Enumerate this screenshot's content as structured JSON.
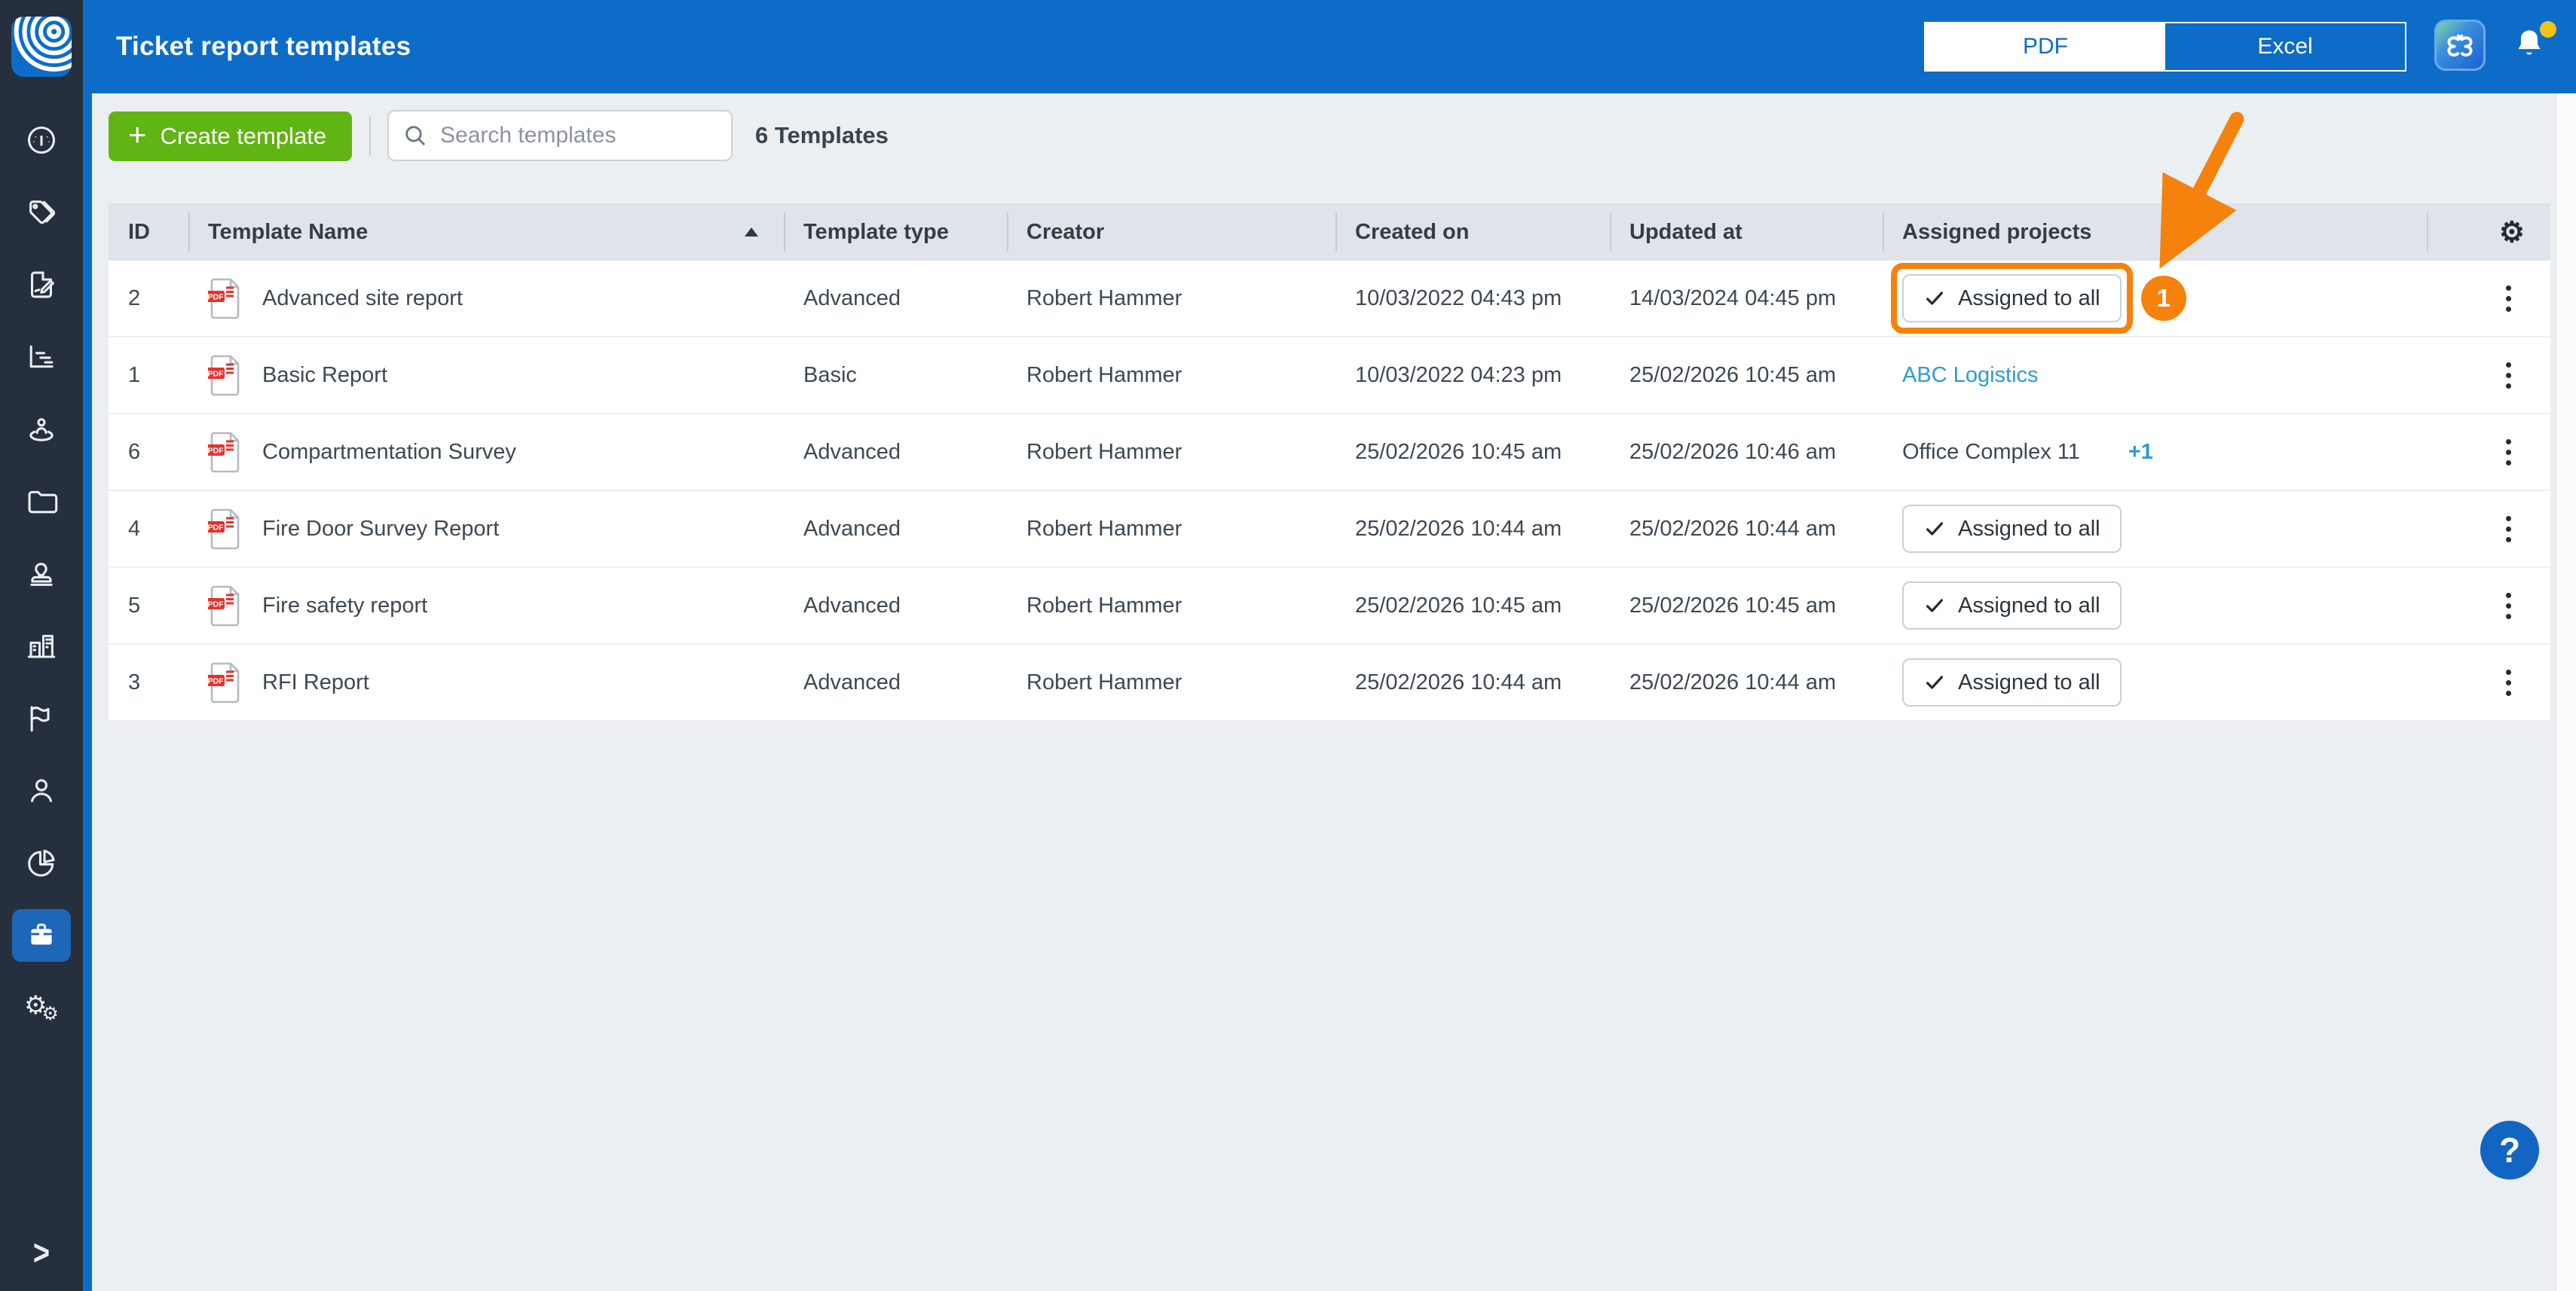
{
  "header": {
    "title": "Ticket report templates",
    "format_toggle": {
      "options": [
        "PDF",
        "Excel"
      ],
      "selected": "PDF"
    }
  },
  "sidebar": {
    "items": [
      {
        "icon": "gauge-icon"
      },
      {
        "icon": "tags-icon"
      },
      {
        "icon": "document-edit-icon"
      },
      {
        "icon": "bar-chart-icon"
      },
      {
        "icon": "person-pin-icon"
      },
      {
        "icon": "folder-icon"
      },
      {
        "icon": "stamp-icon"
      },
      {
        "icon": "buildings-icon"
      },
      {
        "icon": "flag-icon"
      },
      {
        "icon": "user-icon"
      },
      {
        "icon": "pie-chart-icon"
      },
      {
        "icon": "briefcase-icon",
        "selected": true
      },
      {
        "icon": "gears-icon"
      }
    ],
    "expand_chevron": ">"
  },
  "toolbar": {
    "create_label": "Create template",
    "plus": "+",
    "search_placeholder": "Search templates",
    "count_label": "6 Templates"
  },
  "table": {
    "columns": [
      "ID",
      "Template Name",
      "Template type",
      "Creator",
      "Created on",
      "Updated at",
      "Assigned projects",
      ""
    ],
    "sorted_column": "Template Name",
    "sort_direction": "asc",
    "rows": [
      {
        "id": "2",
        "name": "Advanced site report",
        "type": "Advanced",
        "creator": "Robert Hammer",
        "created_on": "10/03/2022 04:43 pm",
        "updated_at": "14/03/2024 04:45 pm",
        "assigned": {
          "kind": "button",
          "label": "Assigned to all",
          "highlighted": true
        }
      },
      {
        "id": "1",
        "name": "Basic Report",
        "type": "Basic",
        "creator": "Robert Hammer",
        "created_on": "10/03/2022 04:23 pm",
        "updated_at": "25/02/2026 10:45 am",
        "assigned": {
          "kind": "link",
          "label": "ABC Logistics"
        }
      },
      {
        "id": "6",
        "name": "Compartmentation Survey",
        "type": "Advanced",
        "creator": "Robert Hammer",
        "created_on": "25/02/2026 10:45 am",
        "updated_at": "25/02/2026 10:46 am",
        "assigned": {
          "kind": "text",
          "label": "Office Complex 11",
          "more": "+1"
        }
      },
      {
        "id": "4",
        "name": "Fire Door Survey Report",
        "type": "Advanced",
        "creator": "Robert Hammer",
        "created_on": "25/02/2026 10:44 am",
        "updated_at": "25/02/2026 10:44 am",
        "assigned": {
          "kind": "button",
          "label": "Assigned to all"
        }
      },
      {
        "id": "5",
        "name": "Fire safety report",
        "type": "Advanced",
        "creator": "Robert Hammer",
        "created_on": "25/02/2026 10:45 am",
        "updated_at": "25/02/2026 10:45 am",
        "assigned": {
          "kind": "button",
          "label": "Assigned to all"
        }
      },
      {
        "id": "3",
        "name": "RFI Report",
        "type": "Advanced",
        "creator": "Robert Hammer",
        "created_on": "25/02/2026 10:44 am",
        "updated_at": "25/02/2026 10:44 am",
        "assigned": {
          "kind": "button",
          "label": "Assigned to all"
        }
      }
    ]
  },
  "annotations": {
    "badge": "1"
  },
  "help_label": "?",
  "colors": {
    "header_blue": "#0d6cc8",
    "sidebar_dark": "#262f3d",
    "selected_blue": "#1e66b8",
    "content_bg": "#ebeff2",
    "table_header_bg": "#dee4e9",
    "green": "#60b413",
    "orange": "#f5820c",
    "link_blue": "#2d9bd8",
    "notification_dot": "#f0c419",
    "help_blue": "#1365c4",
    "pdf_red": "#e5322d"
  }
}
